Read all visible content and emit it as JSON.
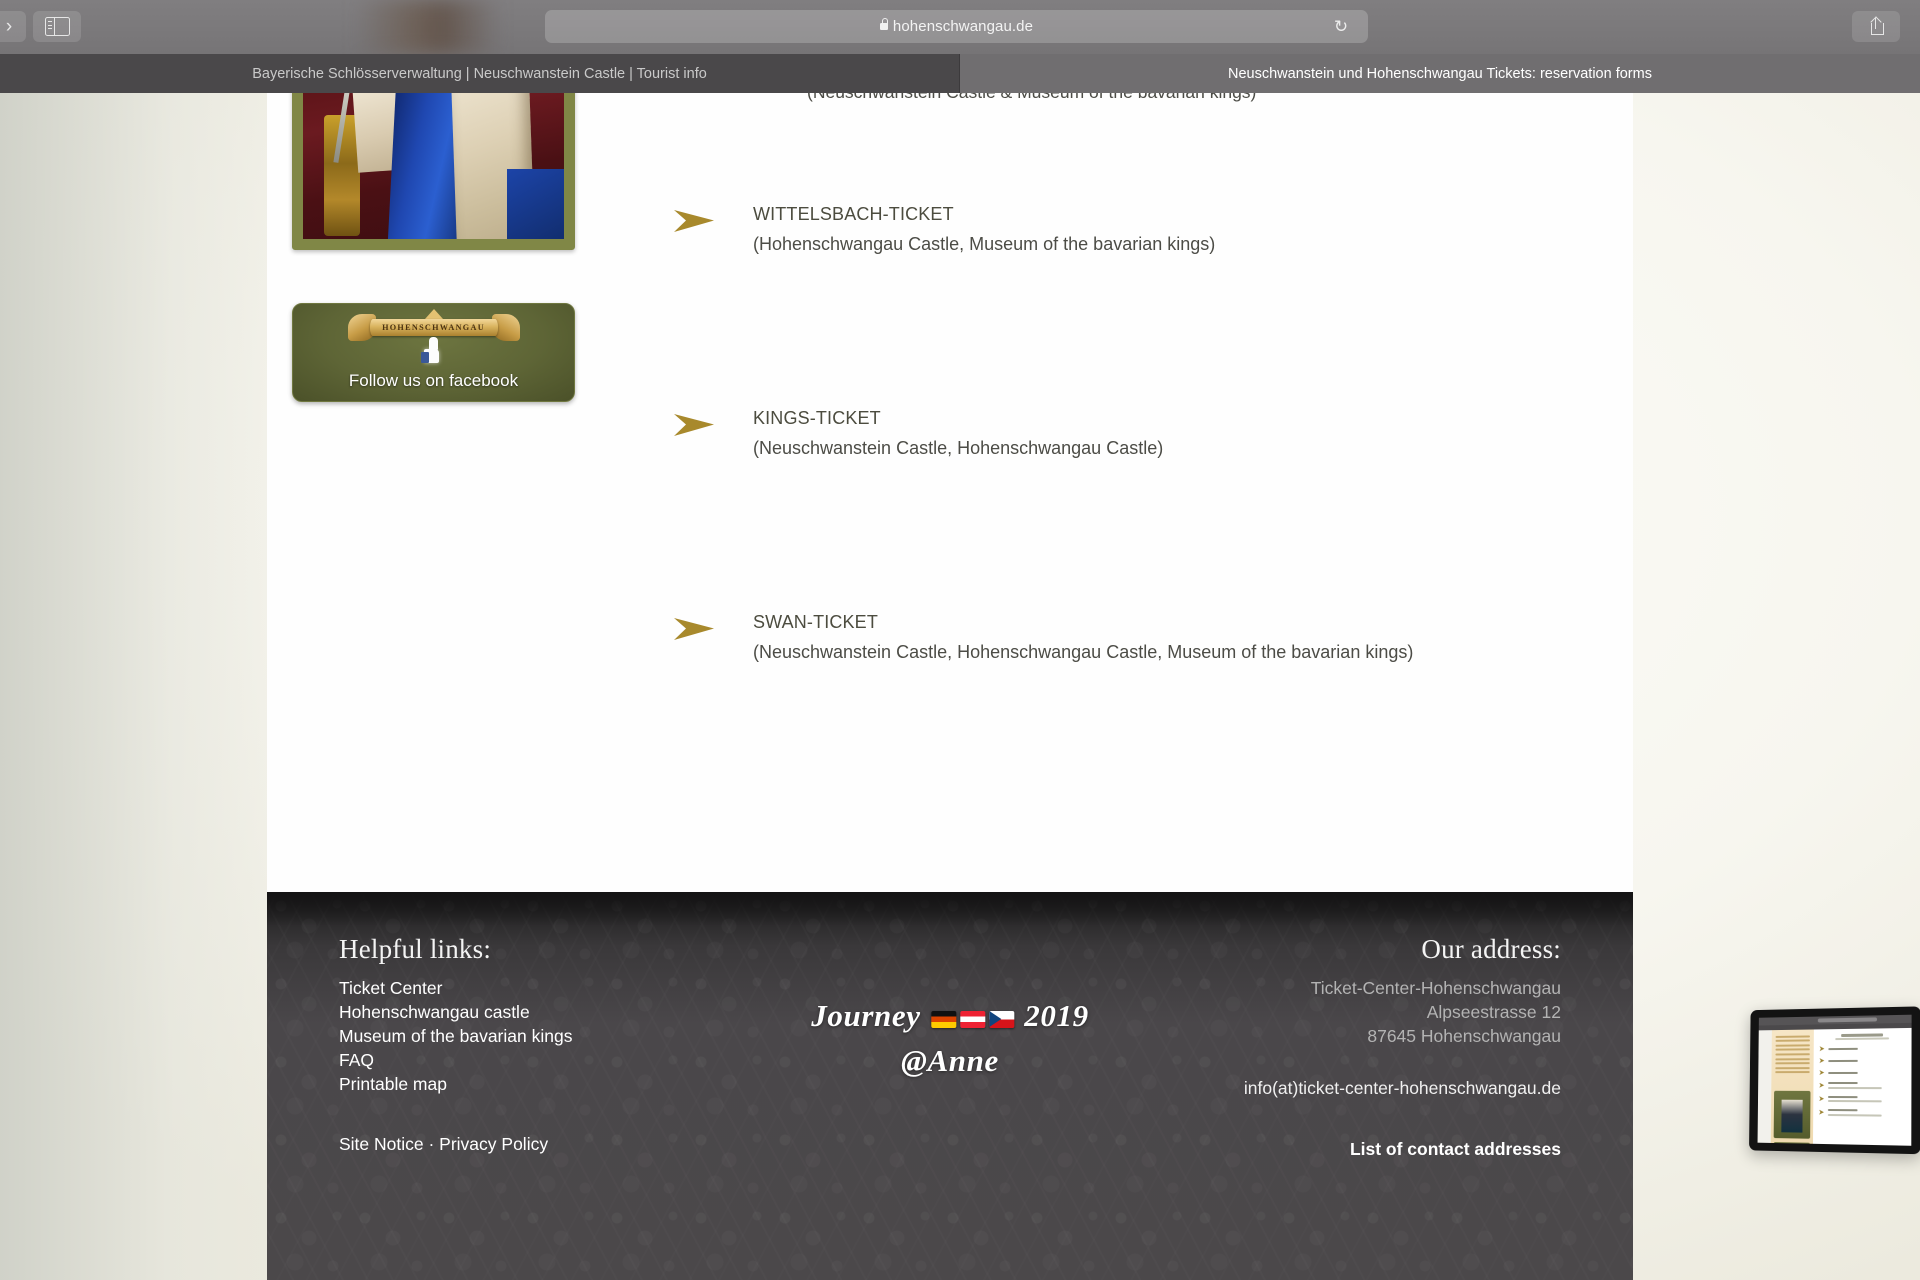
{
  "browser": {
    "url": "hohenschwangau.de",
    "lock_icon": "lock-icon",
    "reload_icon": "reload-icon",
    "share_icon": "share-icon",
    "sidebar_icon": "sidebar-toggle-icon",
    "forward_icon": "forward-chevron-icon",
    "tabs": [
      {
        "label": "Bayerische Schlösserverwaltung | Neuschwanstein Castle | Tourist info",
        "active": false
      },
      {
        "label": "Neuschwanstein und Hohenschwangau Tickets: reservation forms",
        "active": true
      }
    ]
  },
  "page": {
    "cut_off_line": "(Neuschwanstein Castle & Museum of the bavarian kings)",
    "sidebar": {
      "portrait_alt": "king-ludwig-portrait",
      "facebook_banner": {
        "ribbon_text": "HOHENSCHWANGAU",
        "cta": "Follow us on facebook",
        "thumb_icon": "facebook-thumbs-up-icon"
      }
    },
    "tickets": [
      {
        "title": "WITTELSBACH-TICKET",
        "subtitle": "(Hohenschwangau Castle, Museum of the bavarian kings)"
      },
      {
        "title": "KINGS-TICKET",
        "subtitle": "(Neuschwanstein Castle, Hohenschwangau Castle)"
      },
      {
        "title": "SWAN-TICKET",
        "subtitle": "(Neuschwanstein Castle, Hohenschwangau Castle, Museum of the bavarian kings)"
      }
    ]
  },
  "footer": {
    "helpful_links_heading": "Helpful links:",
    "links": [
      "Ticket Center",
      "Hohenschwangau castle",
      "Museum of the bavarian kings",
      "FAQ",
      "Printable map"
    ],
    "legal": "Site Notice · Privacy Policy",
    "signature": {
      "line1_pre": "Journey",
      "line1_post": "2019",
      "line2": "@Anne",
      "flags": [
        "flag-de",
        "flag-at",
        "flag-cz"
      ]
    },
    "address_heading": "Our address:",
    "address_lines": [
      "Ticket-Center-Hohenschwangau",
      "Alpseestrasse 12",
      "87645 Hohenschwangau"
    ],
    "email": "info(at)ticket-center-hohenschwangau.de",
    "contact_link": "List of contact addresses"
  },
  "colors": {
    "arrow_gold": "#a8892c",
    "banner_olive": "#5e6536",
    "footer_dark": "#4b484a",
    "tab_active": "#706e70",
    "toolbar": "#7b797b"
  }
}
